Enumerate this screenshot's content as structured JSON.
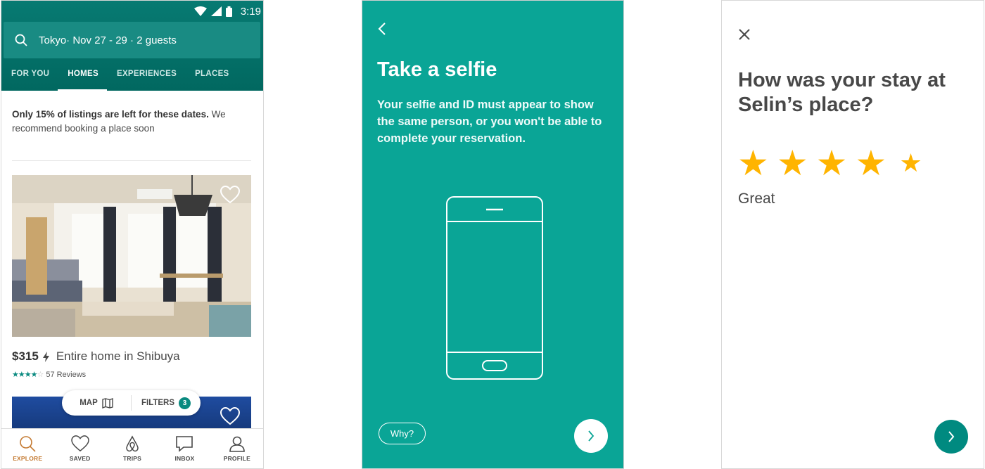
{
  "explore": {
    "status_time": "3:19",
    "search": "Tokyo· Nov 27 - 29 · 2 guests",
    "tabs": [
      "FOR YOU",
      "HOMES",
      "EXPERIENCES",
      "PLACES"
    ],
    "active_tab": "HOMES",
    "notice_bold": "Only 15% of listings are left for these dates.",
    "notice_rest": "We recommend booking a place soon",
    "listing": {
      "price": "$315",
      "title": "Entire home in Shibuya",
      "rating": 4,
      "reviews": "57 Reviews"
    },
    "map_label": "MAP",
    "filters_label": "FILTERS",
    "filters_count": "3",
    "nav": [
      "EXPLORE",
      "SAVED",
      "TRIPS",
      "INBOX",
      "PROFILE"
    ],
    "colors": {
      "header": "#006e68",
      "active_nav": "#c47a32",
      "teal": "#0a8a80"
    }
  },
  "selfie": {
    "title": "Take a selfie",
    "description": "Your selfie and ID must appear to show the same person, or you won't be able to complete your reservation.",
    "why_label": "Why?",
    "colors": {
      "background": "#0aa596"
    }
  },
  "review": {
    "title": "How was your stay at Selin’s place?",
    "rating": 4,
    "rating_label": "Great",
    "colors": {
      "star": "#ffb400",
      "next_button": "#008a80"
    }
  }
}
